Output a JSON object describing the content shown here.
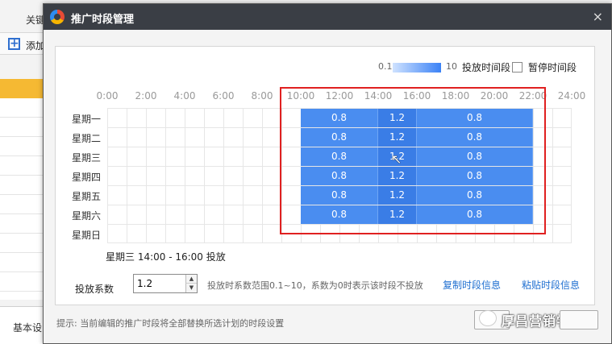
{
  "background_app": {
    "tab_label": "关键",
    "add_label": "添加",
    "bottom_tab_label": "基本设"
  },
  "dialog": {
    "title": "推广时段管理",
    "close_symbol": "×"
  },
  "legend": {
    "min": "0.1",
    "max": "10",
    "label": "投放时间段",
    "pause_label": "暂停时间段",
    "pause_checked": false
  },
  "hour_labels": [
    "0:00",
    "2:00",
    "4:00",
    "6:00",
    "8:00",
    "10:00",
    "12:00",
    "14:00",
    "16:00",
    "18:00",
    "20:00",
    "22:00",
    "24:00"
  ],
  "days": [
    "星期一",
    "星期二",
    "星期三",
    "星期四",
    "星期五",
    "星期六",
    "星期日"
  ],
  "schedule": {
    "rows": [
      {
        "day": "星期一",
        "blocks": [
          {
            "start": 10,
            "end": 14,
            "value": "0.8"
          },
          {
            "start": 14,
            "end": 16,
            "value": "1.2"
          },
          {
            "start": 16,
            "end": 22,
            "value": "0.8"
          }
        ]
      },
      {
        "day": "星期二",
        "blocks": [
          {
            "start": 10,
            "end": 14,
            "value": "0.8"
          },
          {
            "start": 14,
            "end": 16,
            "value": "1.2"
          },
          {
            "start": 16,
            "end": 22,
            "value": "0.8"
          }
        ]
      },
      {
        "day": "星期三",
        "blocks": [
          {
            "start": 10,
            "end": 14,
            "value": "0.8"
          },
          {
            "start": 14,
            "end": 16,
            "value": "1.2"
          },
          {
            "start": 16,
            "end": 22,
            "value": "0.8"
          }
        ]
      },
      {
        "day": "星期四",
        "blocks": [
          {
            "start": 10,
            "end": 14,
            "value": "0.8"
          },
          {
            "start": 14,
            "end": 16,
            "value": "1.2"
          },
          {
            "start": 16,
            "end": 22,
            "value": "0.8"
          }
        ]
      },
      {
        "day": "星期五",
        "blocks": [
          {
            "start": 10,
            "end": 14,
            "value": "0.8"
          },
          {
            "start": 14,
            "end": 16,
            "value": "1.2"
          },
          {
            "start": 16,
            "end": 22,
            "value": "0.8"
          }
        ]
      },
      {
        "day": "星期六",
        "blocks": [
          {
            "start": 10,
            "end": 14,
            "value": "0.8"
          },
          {
            "start": 14,
            "end": 16,
            "value": "1.2"
          },
          {
            "start": 16,
            "end": 22,
            "value": "0.8"
          }
        ]
      },
      {
        "day": "星期日",
        "blocks": []
      }
    ],
    "colors": {
      "block": "#4a8df0",
      "selection_outline": "#e02020"
    }
  },
  "selection_info": "星期三 14:00 - 16:00 投放",
  "coefficient": {
    "label": "投放系数",
    "value": "1.2",
    "hint": "投放时系数范围0.1~10，系数为0时表示该时段不投放"
  },
  "links": {
    "copy": "复制时段信息",
    "paste": "粘贴时段信息"
  },
  "tip": "提示: 当前编辑的推广时段将全部替换所选计划的时段设置",
  "watermark": "厚昌营销学园"
}
